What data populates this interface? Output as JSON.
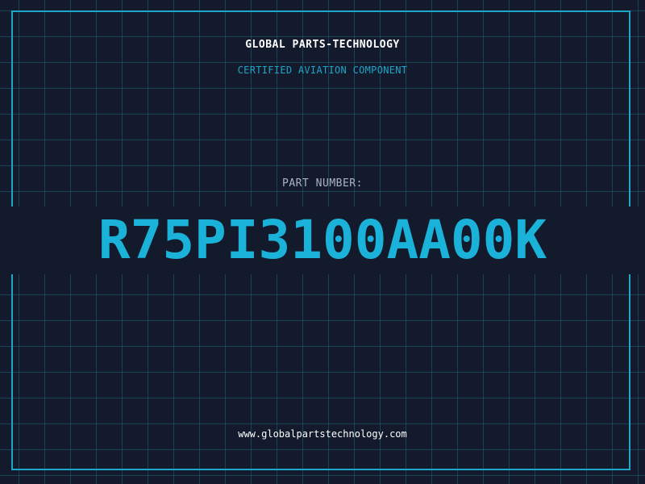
{
  "header": {
    "company": "GLOBAL PARTS-TECHNOLOGY",
    "subtitle": "CERTIFIED AVIATION COMPONENT"
  },
  "part": {
    "label": "PART NUMBER:",
    "number": "R75PI3100AA00K"
  },
  "footer": {
    "url": "www.globalpartstechnology.com"
  },
  "colors": {
    "background": "#121a2c",
    "grid": "#206078",
    "accent": "#1ea6c8",
    "part_number": "#1ab2d8",
    "title_text": "#ffffff",
    "label_text": "#aab4c2"
  }
}
